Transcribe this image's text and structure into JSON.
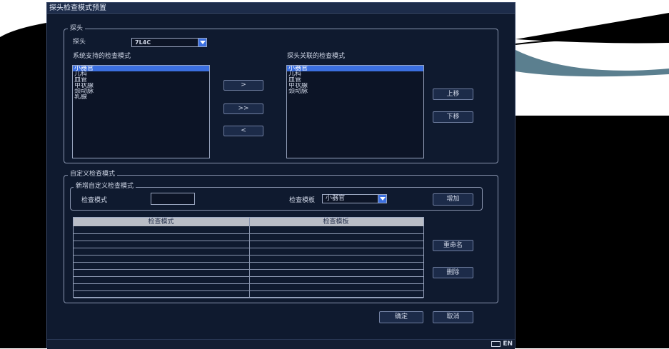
{
  "window": {
    "title": "探头检查模式预置"
  },
  "probe_group": {
    "legend": "探头",
    "probe_label": "探头",
    "probe_value": "7L4C",
    "system_modes_label": "系统支持的检查模式",
    "system_modes": [
      "小器官",
      "儿科",
      "血管",
      "甲状腺",
      "颈动脉",
      "乳腺"
    ],
    "probe_modes_label": "探头关联的检查模式",
    "probe_modes": [
      "小器官",
      "儿科",
      "血管",
      "甲状腺",
      "颈动脉"
    ],
    "add_button": ">",
    "add_all_button": ">>",
    "remove_button": "<",
    "move_up_button": "上移",
    "move_down_button": "下移"
  },
  "custom_group": {
    "legend": "自定义检查模式",
    "new_legend": "新增自定义检查模式",
    "mode_label": "检查模式",
    "mode_value": "",
    "template_label": "检查模板",
    "template_value": "小器官",
    "add_button": "增加",
    "table_headers": [
      "检查模式",
      "检查模板"
    ],
    "rename_button": "重命名",
    "delete_button": "删除"
  },
  "footer": {
    "ok_button": "确定",
    "cancel_button": "取消"
  },
  "status": {
    "lang": "EN"
  }
}
